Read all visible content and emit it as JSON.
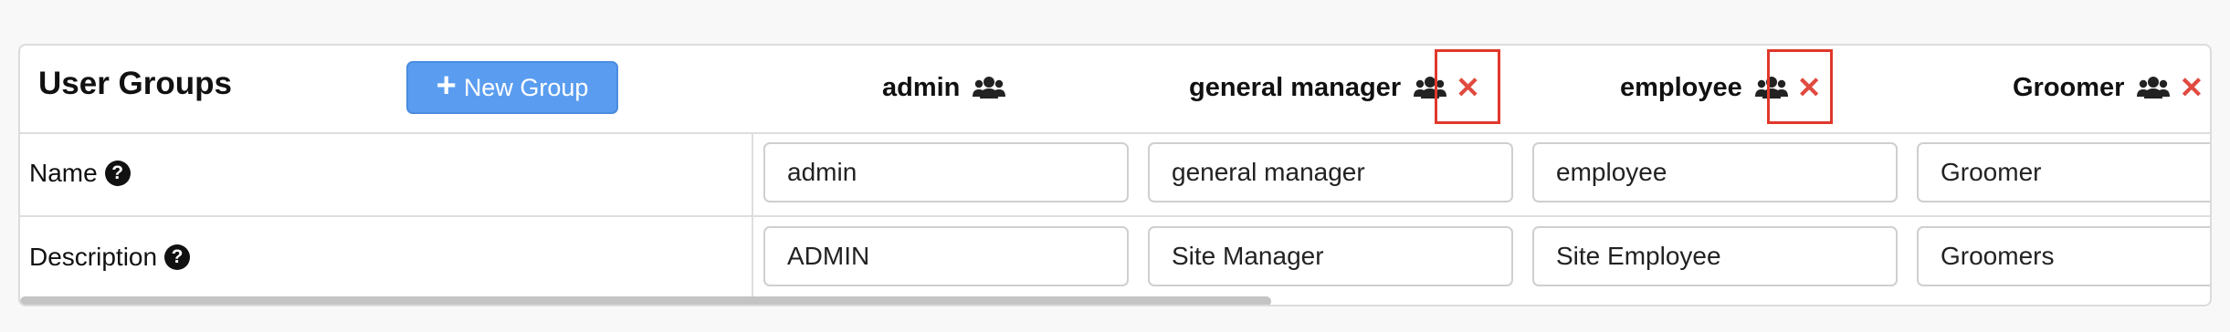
{
  "panel": {
    "title": "User Groups",
    "new_group_label": "New Group"
  },
  "groups": [
    {
      "name": "admin",
      "name_value": "admin",
      "description_value": "ADMIN",
      "deletable": false
    },
    {
      "name": "general manager",
      "name_value": "general manager",
      "description_value": "Site Manager",
      "deletable": true
    },
    {
      "name": "employee",
      "name_value": "employee",
      "description_value": "Site Employee",
      "deletable": true
    },
    {
      "name": "Groomer",
      "name_value": "Groomer",
      "description_value": "Groomers",
      "deletable": true
    }
  ],
  "rows": {
    "name_label": "Name",
    "description_label": "Description"
  },
  "icons": {
    "group": "users-icon",
    "delete": "close-icon",
    "help": "question-circle-icon",
    "add": "plus-icon"
  },
  "colors": {
    "primary_button": "#5a9df0",
    "delete": "#e04a3f",
    "highlight_box": "#e0382b"
  }
}
